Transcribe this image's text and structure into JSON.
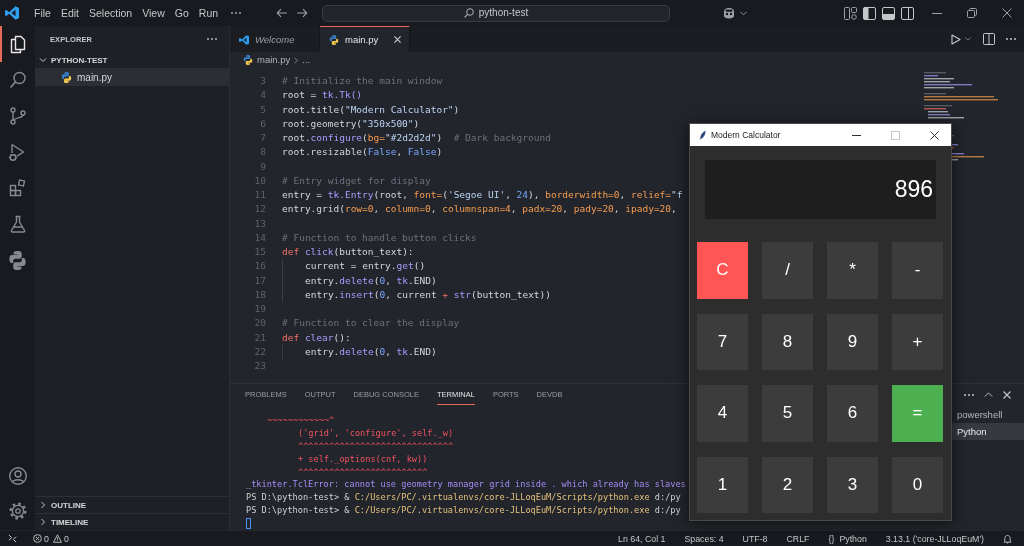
{
  "window": {
    "menu": [
      "File",
      "Edit",
      "Selection",
      "View",
      "Go",
      "Run"
    ],
    "search": "python-test"
  },
  "activity_bar": {
    "items": [
      {
        "selected": true
      },
      {
        "selected": false
      },
      {
        "selected": false
      },
      {
        "selected": false
      },
      {
        "selected": false
      },
      {
        "selected": false
      },
      {
        "selected": false
      }
    ]
  },
  "sidebar": {
    "title": "EXPLORER",
    "folder": {
      "name": "PYTHON-TEST",
      "expanded": true,
      "children": [
        {
          "name": "main.py",
          "selected": true
        }
      ]
    },
    "sections": [
      {
        "name": "OUTLINE",
        "expanded": false
      },
      {
        "name": "TIMELINE",
        "expanded": false
      }
    ]
  },
  "editor": {
    "tabs": [
      {
        "label": "Welcome",
        "kind": "welcome",
        "preview": true,
        "selected": false
      },
      {
        "label": "main.py",
        "kind": "python",
        "preview": false,
        "selected": true
      }
    ],
    "breadcrumb": {
      "file": "main.py",
      "rest": "..."
    },
    "lines": [
      {
        "number": "3",
        "indented": false,
        "tokens": [
          {
            "kind": "comment",
            "text": "# Initialize the main window"
          }
        ]
      },
      {
        "number": "4",
        "indented": false,
        "tokens": [
          {
            "kind": "plain",
            "text": "root = "
          },
          {
            "kind": "name",
            "text": "tk.Tk()"
          }
        ]
      },
      {
        "number": "5",
        "indented": false,
        "tokens": [
          {
            "kind": "plain",
            "text": "root.title("
          },
          {
            "kind": "string",
            "text": "\"Modern Calculator\""
          },
          {
            "kind": "plain",
            "text": ")"
          }
        ]
      },
      {
        "number": "6",
        "indented": false,
        "tokens": [
          {
            "kind": "plain",
            "text": "root.geometry("
          },
          {
            "kind": "string",
            "text": "\"350x500\""
          },
          {
            "kind": "plain",
            "text": ")"
          }
        ]
      },
      {
        "number": "7",
        "indented": false,
        "tokens": [
          {
            "kind": "plain",
            "text": "root."
          },
          {
            "kind": "name",
            "text": "configure"
          },
          {
            "kind": "plain",
            "text": "("
          },
          {
            "kind": "param",
            "text": "bg="
          },
          {
            "kind": "string",
            "text": "\"#2d2d2d\""
          },
          {
            "kind": "plain",
            "text": ")  "
          },
          {
            "kind": "comment",
            "text": "# Dark background"
          }
        ]
      },
      {
        "number": "8",
        "indented": false,
        "tokens": [
          {
            "kind": "plain",
            "text": "root.resizable("
          },
          {
            "kind": "number",
            "text": "False"
          },
          {
            "kind": "plain",
            "text": ", "
          },
          {
            "kind": "number",
            "text": "False"
          },
          {
            "kind": "plain",
            "text": ")"
          }
        ]
      },
      {
        "number": "9",
        "indented": false
      },
      {
        "number": "10",
        "indented": false,
        "tokens": [
          {
            "kind": "comment",
            "text": "# Entry widget for display"
          }
        ]
      },
      {
        "number": "11",
        "indented": false,
        "tokens": [
          {
            "kind": "plain",
            "text": "entry = "
          },
          {
            "kind": "name",
            "text": "tk.Entry"
          },
          {
            "kind": "plain",
            "text": "(root, "
          },
          {
            "kind": "param",
            "text": "font="
          },
          {
            "kind": "plain",
            "text": "("
          },
          {
            "kind": "string",
            "text": "'Segoe UI'"
          },
          {
            "kind": "plain",
            "text": ", "
          },
          {
            "kind": "number",
            "text": "24"
          },
          {
            "kind": "plain",
            "text": "), "
          },
          {
            "kind": "param",
            "text": "borderwidth=0"
          },
          {
            "kind": "plain",
            "text": ", "
          },
          {
            "kind": "param",
            "text": "relief="
          },
          {
            "kind": "string",
            "text": "\"f"
          }
        ]
      },
      {
        "number": "12",
        "indented": false,
        "tokens": [
          {
            "kind": "plain",
            "text": "entry.grid("
          },
          {
            "kind": "param",
            "text": "row=0"
          },
          {
            "kind": "plain",
            "text": ", "
          },
          {
            "kind": "param",
            "text": "column=0"
          },
          {
            "kind": "plain",
            "text": ", "
          },
          {
            "kind": "param",
            "text": "columnspan=4"
          },
          {
            "kind": "plain",
            "text": ", "
          },
          {
            "kind": "param",
            "text": "padx=20"
          },
          {
            "kind": "plain",
            "text": ", "
          },
          {
            "kind": "param",
            "text": "pady=20"
          },
          {
            "kind": "plain",
            "text": ", "
          },
          {
            "kind": "param",
            "text": "ipady=20"
          },
          {
            "kind": "plain",
            "text": ","
          }
        ]
      },
      {
        "number": "13",
        "indented": false
      },
      {
        "number": "14",
        "indented": false,
        "tokens": [
          {
            "kind": "comment",
            "text": "# Function to handle button clicks"
          }
        ]
      },
      {
        "number": "15",
        "indented": false,
        "tokens": [
          {
            "kind": "keyword",
            "text": "def "
          },
          {
            "kind": "name",
            "text": "click"
          },
          {
            "kind": "plain",
            "text": "(button_text):"
          }
        ]
      },
      {
        "number": "16",
        "indented": true,
        "tokens": [
          {
            "kind": "plain",
            "text": "current = entry."
          },
          {
            "kind": "name",
            "text": "get"
          },
          {
            "kind": "plain",
            "text": "()"
          }
        ]
      },
      {
        "number": "17",
        "indented": true,
        "tokens": [
          {
            "kind": "plain",
            "text": "entry."
          },
          {
            "kind": "name",
            "text": "delete"
          },
          {
            "kind": "plain",
            "text": "("
          },
          {
            "kind": "number",
            "text": "0"
          },
          {
            "kind": "plain",
            "text": ", "
          },
          {
            "kind": "name",
            "text": "tk"
          },
          {
            "kind": "plain",
            "text": ".END)"
          }
        ]
      },
      {
        "number": "18",
        "indented": true,
        "tokens": [
          {
            "kind": "plain",
            "text": "entry."
          },
          {
            "kind": "name",
            "text": "insert"
          },
          {
            "kind": "plain",
            "text": "("
          },
          {
            "kind": "number",
            "text": "0"
          },
          {
            "kind": "plain",
            "text": ", current "
          },
          {
            "kind": "keyword",
            "text": "+ "
          },
          {
            "kind": "name",
            "text": "str"
          },
          {
            "kind": "plain",
            "text": "(button_text))"
          }
        ]
      },
      {
        "number": "19",
        "indented": false
      },
      {
        "number": "20",
        "indented": false,
        "tokens": [
          {
            "kind": "comment",
            "text": "# Function to clear the display"
          }
        ]
      },
      {
        "number": "21",
        "indented": false,
        "tokens": [
          {
            "kind": "keyword",
            "text": "def "
          },
          {
            "kind": "name",
            "text": "clear"
          },
          {
            "kind": "plain",
            "text": "():"
          }
        ]
      },
      {
        "number": "22",
        "indented": true,
        "tokens": [
          {
            "kind": "plain",
            "text": "entry."
          },
          {
            "kind": "name",
            "text": "delete"
          },
          {
            "kind": "plain",
            "text": "("
          },
          {
            "kind": "number",
            "text": "0"
          },
          {
            "kind": "plain",
            "text": ", "
          },
          {
            "kind": "name",
            "text": "tk"
          },
          {
            "kind": "plain",
            "text": ".END)"
          }
        ]
      },
      {
        "number": "23",
        "indented": false
      }
    ]
  },
  "panel": {
    "tabs": [
      {
        "label": "PROBLEMS",
        "selected": false
      },
      {
        "label": "OUTPUT",
        "selected": false
      },
      {
        "label": "DEBUG CONSOLE",
        "selected": false
      },
      {
        "label": "TERMINAL",
        "selected": true
      },
      {
        "label": "PORTS",
        "selected": false
      },
      {
        "label": "DEVDB",
        "selected": false
      }
    ],
    "terminal": [
      {
        "kind": "tilde",
        "text": "~~~~~~~~~~~~^"
      },
      {
        "kind": "trace",
        "text": "('grid', 'configure', self._w)"
      },
      {
        "kind": "trace",
        "text": "^^^^^^^^^^^^^^^^^^^^^^^^^^^^^^"
      },
      {
        "kind": "trace",
        "text": "+ self._options(cnf, kw))"
      },
      {
        "kind": "trace",
        "text": "^^^^^^^^^^^^^^^^^^^^^^^^^"
      },
      {
        "kind": "error",
        "text": "_tkinter.TclError: cannot use geometry manager grid inside . which already has slaves"
      },
      {
        "kind": "prompt",
        "prompt": "PS D:\\python-test> &",
        "command": "C:/Users/PC/.virtualenvs/core-JLLoqEuM/Scripts/python.exe",
        "argument": "d:/py"
      },
      {
        "kind": "prompt",
        "prompt": "PS D:\\python-test> &",
        "command": "C:/Users/PC/.virtualenvs/core-JLLoqEuM/Scripts/python.exe",
        "argument": "d:/py"
      },
      {
        "kind": "cursor"
      }
    ],
    "sessions": [
      {
        "label": "powershell",
        "selected": false
      },
      {
        "label": "Python",
        "selected": true
      }
    ]
  },
  "calculator": {
    "title": "Modern Calculator",
    "window_buttons": [
      {
        "disabled": false
      },
      {
        "disabled": true
      },
      {
        "disabled": false
      }
    ],
    "display": "896",
    "keys": [
      {
        "label": "C",
        "color": "#ff5555"
      },
      {
        "label": "/",
        "color": "#3c3c3c"
      },
      {
        "label": "*",
        "color": "#3c3c3c"
      },
      {
        "label": "-",
        "color": "#3c3c3c"
      },
      {
        "label": "7",
        "color": "#3c3c3c"
      },
      {
        "label": "8",
        "color": "#3c3c3c"
      },
      {
        "label": "9",
        "color": "#3c3c3c"
      },
      {
        "label": "+",
        "color": "#3c3c3c"
      },
      {
        "label": "4",
        "color": "#3c3c3c"
      },
      {
        "label": "5",
        "color": "#3c3c3c"
      },
      {
        "label": "6",
        "color": "#3c3c3c"
      },
      {
        "label": "=",
        "color": "#4caf50"
      },
      {
        "label": "1",
        "color": "#3c3c3c"
      },
      {
        "label": "2",
        "color": "#3c3c3c"
      },
      {
        "label": "3",
        "color": "#3c3c3c"
      },
      {
        "label": "0",
        "color": "#3c3c3c"
      }
    ]
  },
  "status_bar": {
    "errors": "0",
    "warnings": "0",
    "items": [
      {
        "text": "Ln 64, Col 1"
      },
      {
        "text": "Spaces: 4"
      },
      {
        "text": "UTF-8"
      },
      {
        "text": "CRLF"
      },
      {
        "glyph": "{}",
        "text": "Python"
      },
      {
        "text": "3.13.1 ('core-JLLoqEuM')"
      }
    ]
  }
}
